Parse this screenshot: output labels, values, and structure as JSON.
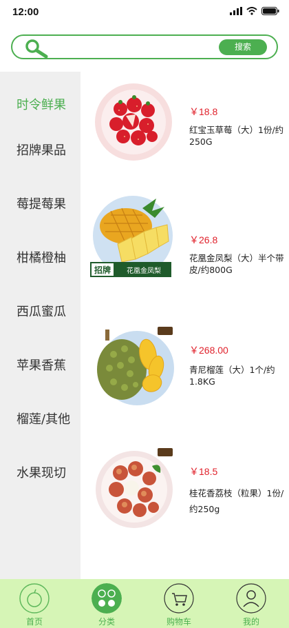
{
  "status": {
    "time": "12:00"
  },
  "search": {
    "placeholder": "",
    "button_label": "搜索"
  },
  "sidebar": {
    "items": [
      {
        "label": "时令鲜果",
        "active": true
      },
      {
        "label": "招牌果品",
        "active": false
      },
      {
        "label": "莓提莓果",
        "active": false
      },
      {
        "label": "柑橘橙柚",
        "active": false
      },
      {
        "label": "西瓜蜜瓜",
        "active": false
      },
      {
        "label": "苹果香蕉",
        "active": false
      },
      {
        "label": "榴莲/其他",
        "active": false
      },
      {
        "label": "水果现切",
        "active": false
      }
    ]
  },
  "products": [
    {
      "price": "￥18.8",
      "name": "红宝玉草莓（大）1份/约250G",
      "image": "strawberry"
    },
    {
      "price": "￥26.8",
      "name": "花凰金凤梨（大）半个带皮/约800G",
      "image": "pineapple",
      "badge": "招牌",
      "banner": "花凰金凤梨"
    },
    {
      "price": "￥268.00",
      "name": "青尼榴莲（大）1个/约1.8KG",
      "image": "durian"
    },
    {
      "price": "￥18.5",
      "name": "桂花香荔枝（粒果）1份/约250g",
      "image": "lychee"
    }
  ],
  "tabbar": {
    "tabs": [
      {
        "label": "首页",
        "icon": "home-fruit-icon"
      },
      {
        "label": "分类",
        "icon": "category-icon",
        "active": true
      },
      {
        "label": "购物车",
        "icon": "cart-icon"
      },
      {
        "label": "我的",
        "icon": "profile-icon"
      }
    ]
  },
  "colors": {
    "accent": "#4caf50",
    "price": "#e0212b",
    "tabbar_bg": "#d6f5b6",
    "sidebar_bg": "#efefef"
  }
}
